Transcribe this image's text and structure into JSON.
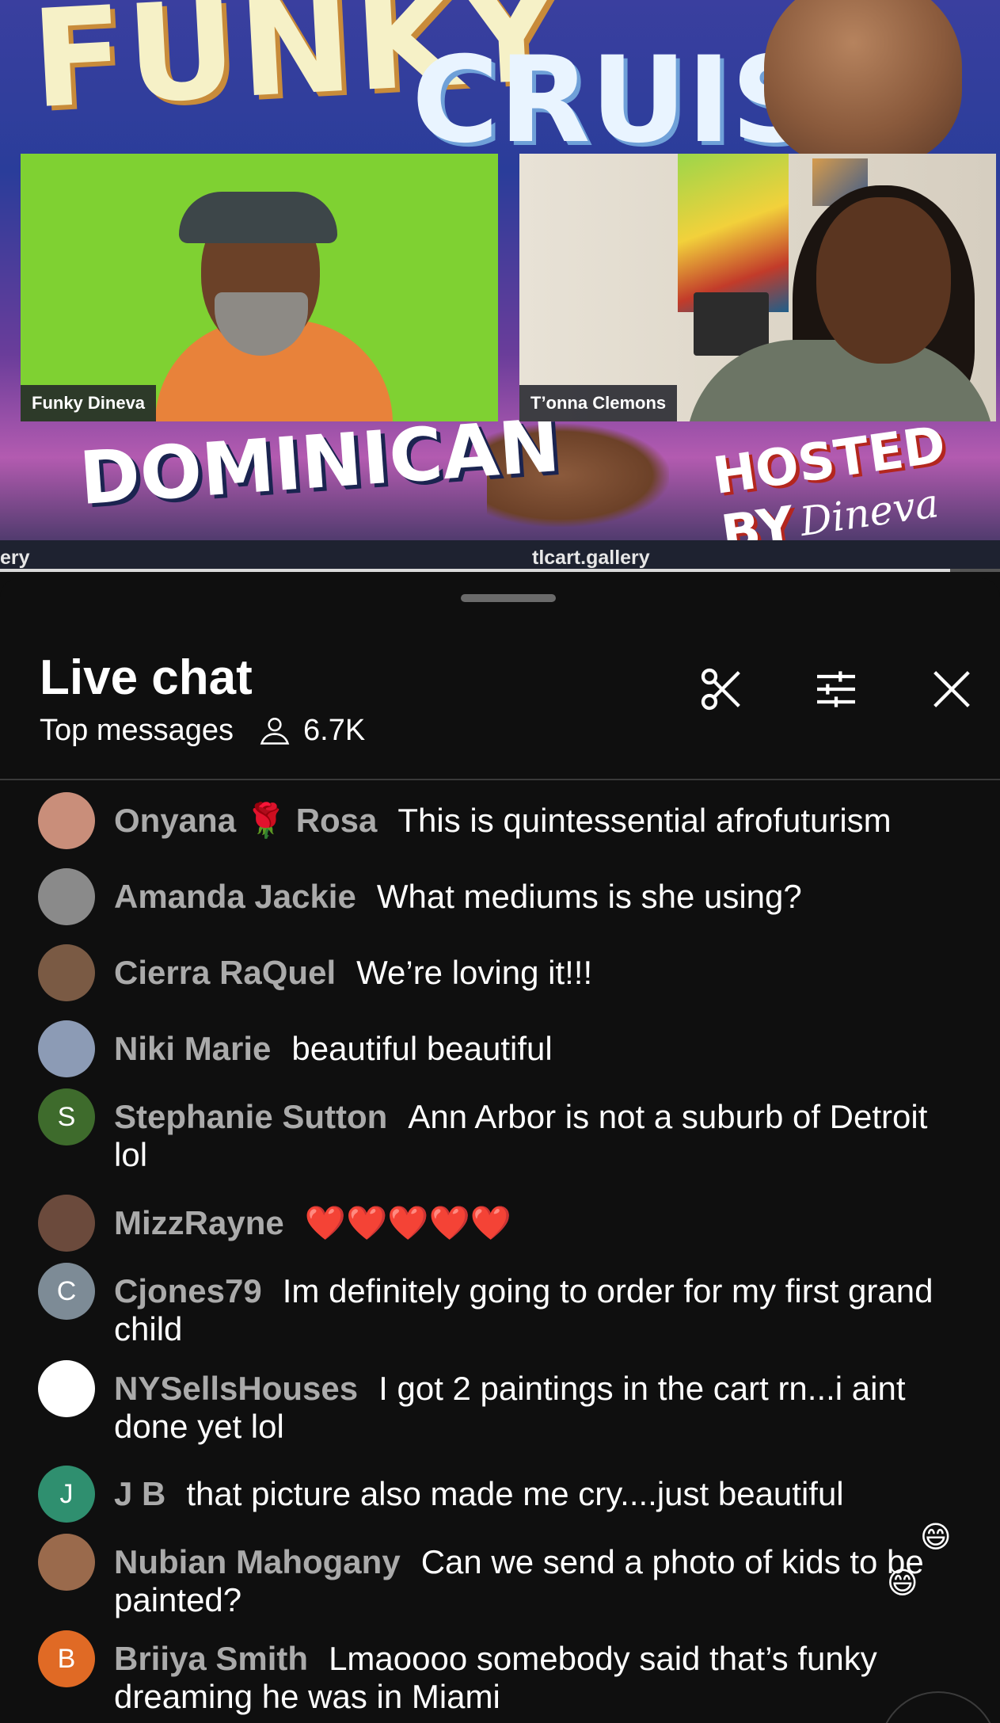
{
  "video": {
    "bg_title_top": "FUNKY",
    "bg_title_top2": "CRUISE",
    "bg_title_bottom": "DOMINICAN",
    "bg_hosted_by": "HOSTED BY",
    "bg_host_script": "Dineva",
    "participants": [
      {
        "name": "Funky Dineva"
      },
      {
        "name": "T’onna Clemons"
      }
    ],
    "url_left": "ery",
    "url": "tlcart.gallery",
    "progress_fraction": 0.95
  },
  "chat": {
    "title": "Live chat",
    "mode": "Top messages",
    "viewer_count": "6.7K",
    "icons": {
      "clip": "scissors-icon",
      "filter": "sliders-icon",
      "close": "close-icon"
    },
    "messages": [
      {
        "author": "Onyana 🌹 Rosa",
        "text": "This is quintessential afrofuturism",
        "avatar_color": "#c98e7a",
        "avatar_letter": ""
      },
      {
        "author": "Amanda Jackie",
        "text": "What mediums is she using?",
        "avatar_color": "#8a8a8a",
        "avatar_letter": ""
      },
      {
        "author": "Cierra RaQuel",
        "text": "We’re loving it!!!",
        "avatar_color": "#7a5a44",
        "avatar_letter": ""
      },
      {
        "author": "Niki Marie",
        "text": "beautiful beautiful",
        "avatar_color": "#8c9bb5",
        "avatar_letter": ""
      },
      {
        "author": "Stephanie Sutton",
        "text": "Ann Arbor is not a suburb of Detroit lol",
        "avatar_color": "#3e6b2c",
        "avatar_letter": "S"
      },
      {
        "author": "MizzRayne",
        "text": "❤️❤️❤️❤️❤️",
        "avatar_color": "#6b4a3c",
        "avatar_letter": ""
      },
      {
        "author": "Cjones79",
        "text": "Im definitely going to order for my first grand child",
        "avatar_color": "#7d8b96",
        "avatar_letter": "C"
      },
      {
        "author": "NYSellsHouses",
        "text": "I got 2 paintings in the cart rn...i aint done yet lol",
        "avatar_color": "#ffffff",
        "avatar_letter": ""
      },
      {
        "author": "J B",
        "text": "that picture also made me cry....just beautiful",
        "avatar_color": "#2f8f6f",
        "avatar_letter": "J"
      },
      {
        "author": "Nubian Mahogany",
        "text": "Can we send a photo of kids to be painted?",
        "avatar_color": "#9a6a4c",
        "avatar_letter": ""
      },
      {
        "author": "Briiya Smith",
        "text": "Lmaoooo somebody said that’s funky dreaming he was in Miami",
        "avatar_color": "#e06a25",
        "avatar_letter": "B"
      }
    ],
    "floating_emoji": "😄"
  }
}
